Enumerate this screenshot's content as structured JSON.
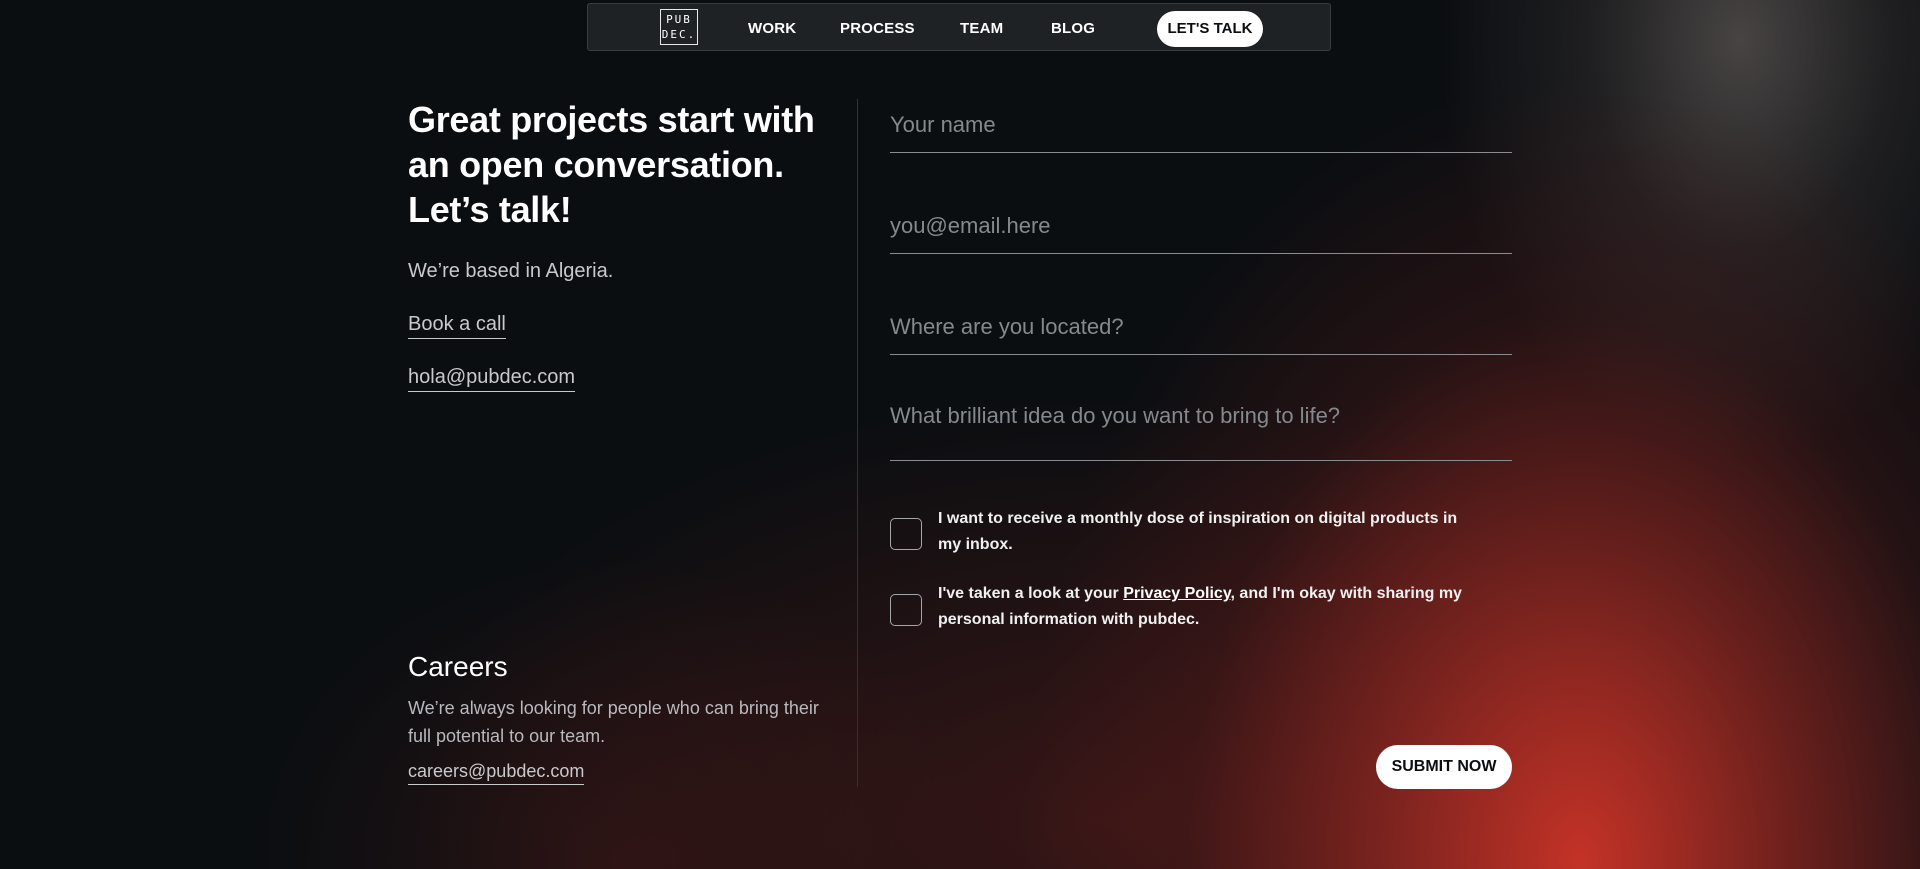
{
  "nav": {
    "logo_top": "PUB",
    "logo_bottom": "DEC.",
    "items": [
      "WORK",
      "PROCESS",
      "TEAM",
      "BLOG"
    ],
    "cta": "LET'S TALK"
  },
  "intro": {
    "headline": "Great projects start with an open conversation. Let’s talk!",
    "location": "We’re based in Algeria.",
    "book_call": "Book a call",
    "email": "hola@pubdec.com"
  },
  "careers": {
    "title": "Careers",
    "description": "We’re always looking for people who can bring their full potential to our team.",
    "email": "careers@pubdec.com"
  },
  "form": {
    "name_placeholder": "Your name",
    "email_placeholder": "you@email.here",
    "location_placeholder": "Where are you located?",
    "idea_placeholder": "What brilliant idea do you want to bring to life?",
    "newsletter_label": "I want to receive a monthly dose of inspiration on digital products in my inbox.",
    "privacy_before": "I've taken a look at your ",
    "privacy_link": "Privacy Policy",
    "privacy_after": ", and I'm okay with sharing my personal information with pubdec.",
    "submit": "SUBMIT NOW"
  },
  "colors": {
    "background": "#0b0e11",
    "accent_glow": "#cd3428",
    "button_bg": "#ffffff"
  }
}
